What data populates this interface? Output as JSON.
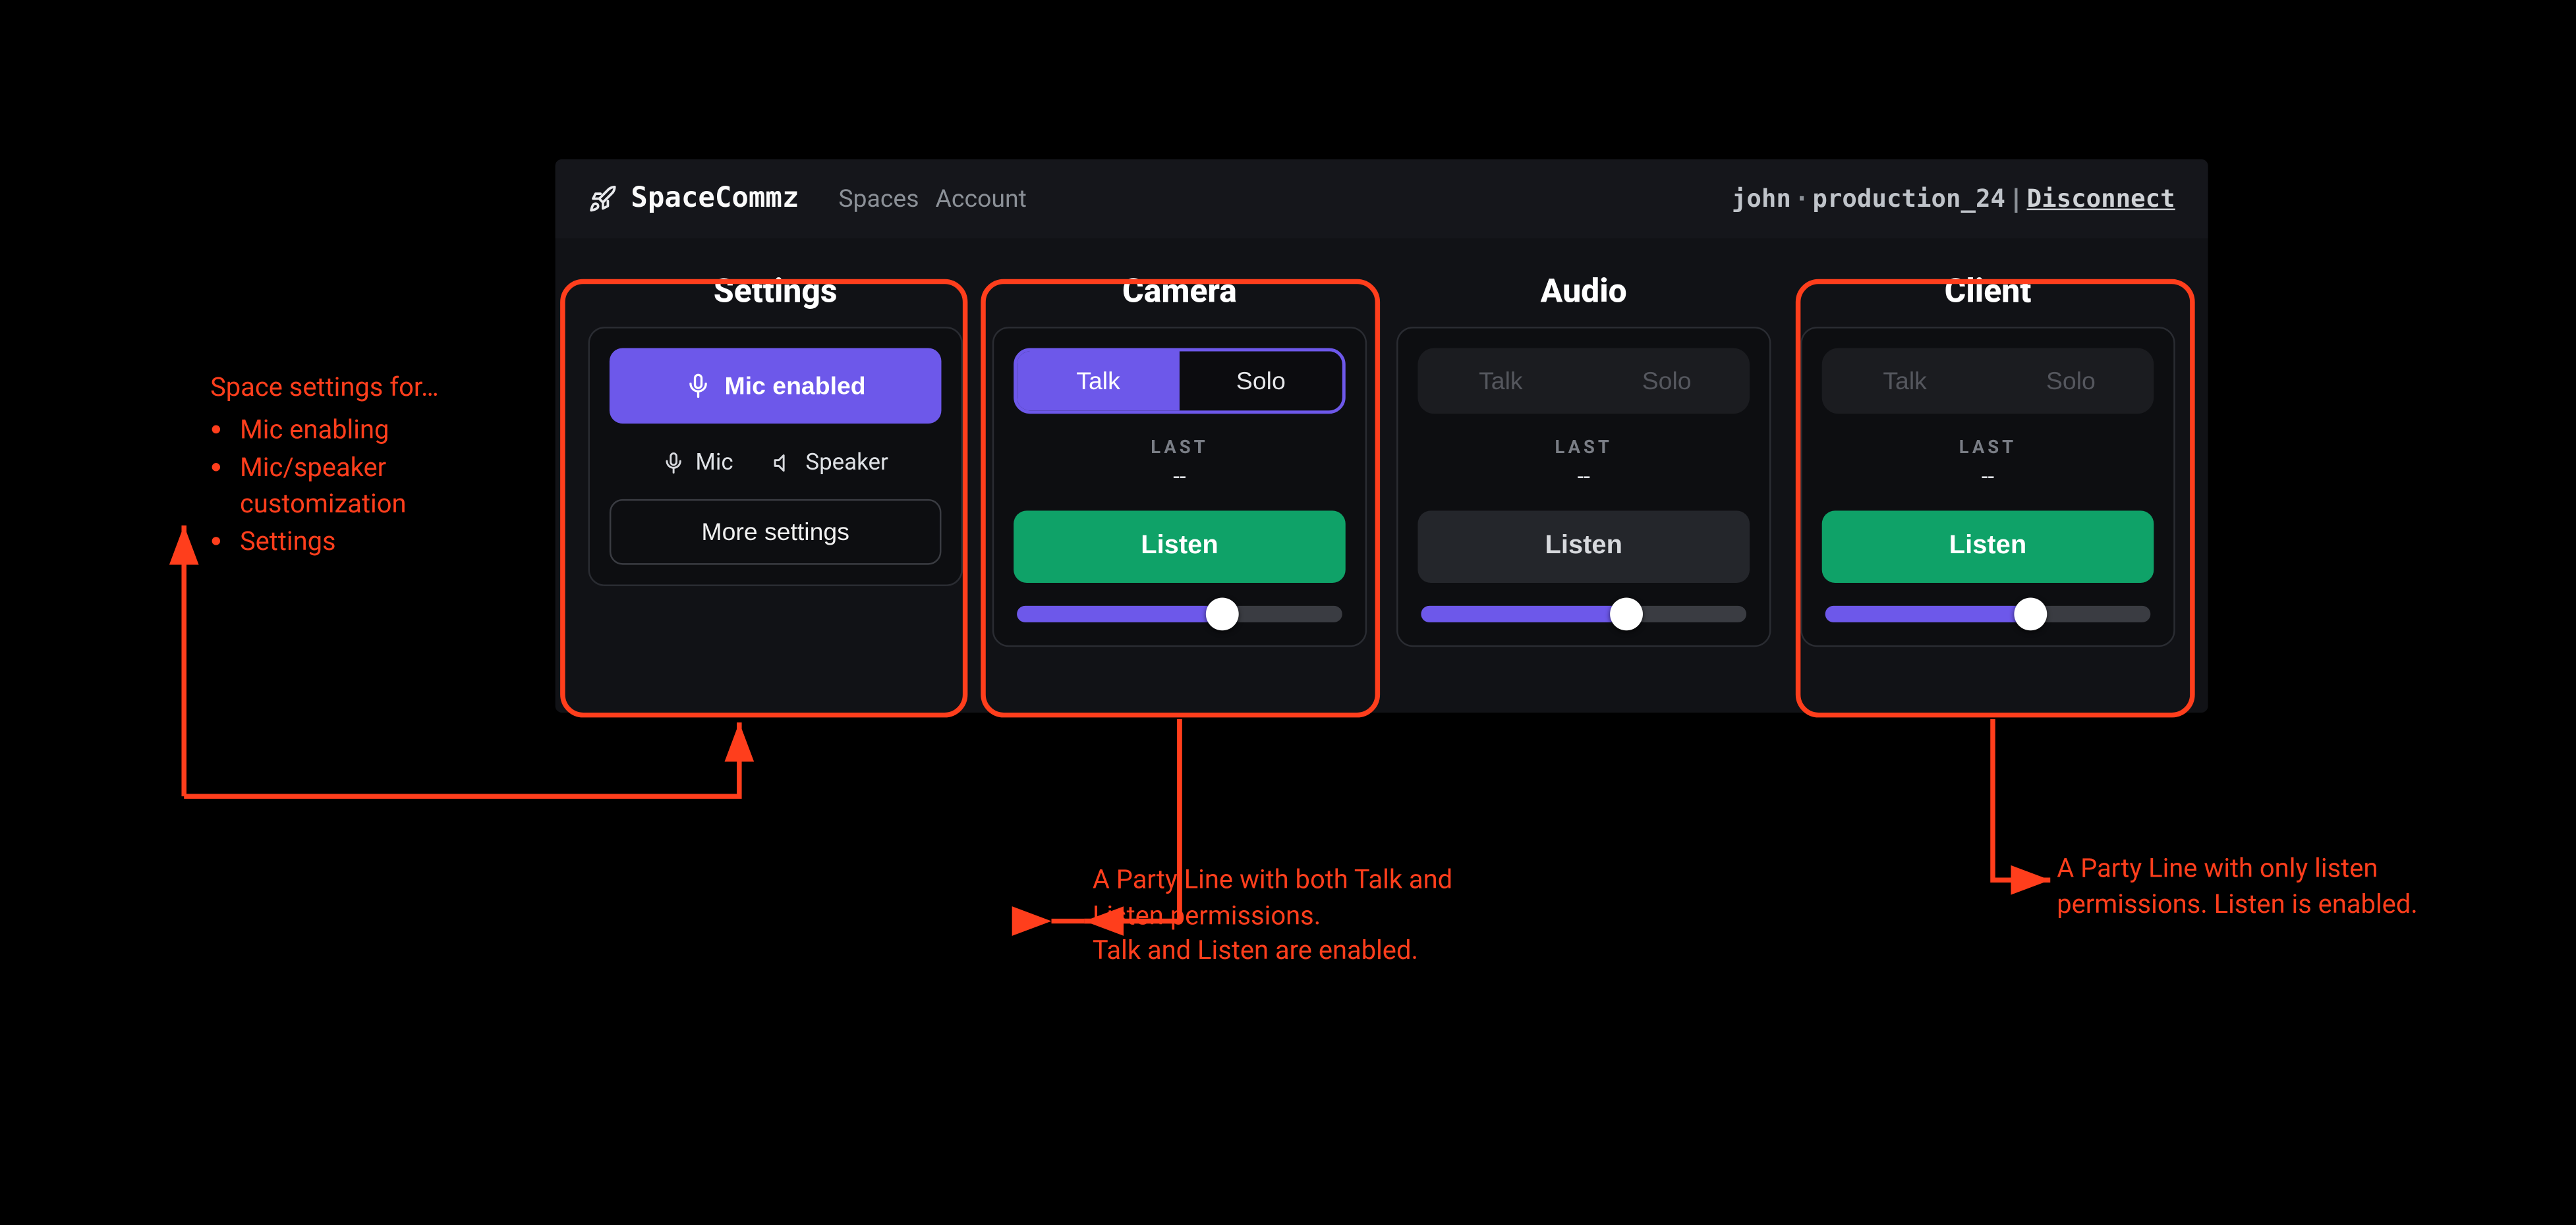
{
  "colors": {
    "accent": "#6d58ea",
    "success": "#0fa268",
    "annotation": "#ff3e1c",
    "app_bg": "#111216",
    "card_bg": "#0d0e11"
  },
  "topbar": {
    "brand": "SpaceCommz",
    "nav": {
      "spaces": "Spaces",
      "account": "Account"
    },
    "user": "john",
    "session": "production_24",
    "dot": " · ",
    "pipe": " | ",
    "disconnect": "Disconnect"
  },
  "panels": {
    "settings": {
      "title": "Settings",
      "mic_enabled": "Mic enabled",
      "mic": "Mic",
      "speaker": "Speaker",
      "more": "More settings"
    },
    "camera": {
      "title": "Camera",
      "talk": "Talk",
      "solo": "Solo",
      "last_label": "LAST",
      "last_value": "--",
      "listen": "Listen",
      "listen_active": true,
      "talk_enabled": true,
      "slider_pct": 63
    },
    "audio": {
      "title": "Audio",
      "talk": "Talk",
      "solo": "Solo",
      "last_label": "LAST",
      "last_value": "--",
      "listen": "Listen",
      "listen_active": false,
      "talk_enabled": false,
      "slider_pct": 63
    },
    "client": {
      "title": "Client",
      "talk": "Talk",
      "solo": "Solo",
      "last_label": "LAST",
      "last_value": "--",
      "listen": "Listen",
      "listen_active": true,
      "talk_enabled": false,
      "slider_pct": 63
    }
  },
  "annotations": {
    "settings": {
      "heading": "Space settings for…",
      "items": [
        "Mic enabling",
        "Mic/speaker customization",
        "Settings"
      ]
    },
    "camera": "A Party Line with both Talk and Listen permissions.\nTalk and Listen are enabled.",
    "client": "A Party Line with only listen permissions. Listen is enabled."
  }
}
